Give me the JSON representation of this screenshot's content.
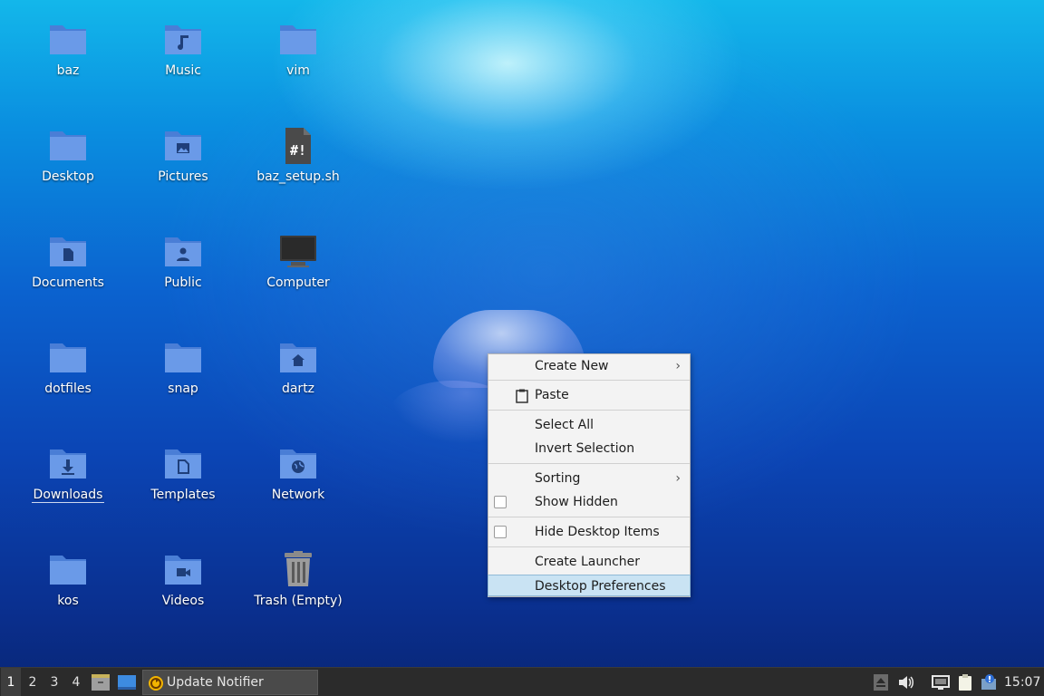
{
  "desktop_icons": [
    {
      "label": "baz",
      "icon": "folder-icon"
    },
    {
      "label": "Music",
      "icon": "folder-music-icon"
    },
    {
      "label": "vim",
      "icon": "folder-icon"
    },
    {
      "label": "Desktop",
      "icon": "folder-icon"
    },
    {
      "label": "Pictures",
      "icon": "folder-pictures-icon"
    },
    {
      "label": "baz_setup.sh",
      "icon": "script-file-icon"
    },
    {
      "label": "Documents",
      "icon": "folder-documents-icon"
    },
    {
      "label": "Public",
      "icon": "folder-public-icon"
    },
    {
      "label": "Computer",
      "icon": "computer-icon"
    },
    {
      "label": "dotfiles",
      "icon": "folder-icon"
    },
    {
      "label": "snap",
      "icon": "folder-icon"
    },
    {
      "label": "dartz",
      "icon": "folder-home-icon"
    },
    {
      "label": "Downloads",
      "icon": "folder-downloads-icon"
    },
    {
      "label": "Templates",
      "icon": "folder-templates-icon"
    },
    {
      "label": "Network",
      "icon": "folder-network-icon"
    },
    {
      "label": "kos",
      "icon": "folder-icon"
    },
    {
      "label": "Videos",
      "icon": "folder-videos-icon"
    },
    {
      "label": "Trash (Empty)",
      "icon": "trash-icon"
    }
  ],
  "context_menu": {
    "create_new": "Create New",
    "paste": "Paste",
    "select_all": "Select All",
    "invert_selection": "Invert Selection",
    "sorting": "Sorting",
    "show_hidden": "Show Hidden",
    "hide_desktop_items": "Hide Desktop Items",
    "create_launcher": "Create Launcher",
    "desktop_preferences": "Desktop Preferences",
    "submenu_arrow": "›"
  },
  "taskbar": {
    "workspaces": [
      "1",
      "2",
      "3",
      "4"
    ],
    "active_workspace": "1",
    "task_label": "Update Notifier",
    "clock": "15:07"
  },
  "colors": {
    "folder": "#5b8fe0",
    "menu_highlight": "#c9e3f3",
    "taskbar_bg": "#2b2b2b"
  }
}
